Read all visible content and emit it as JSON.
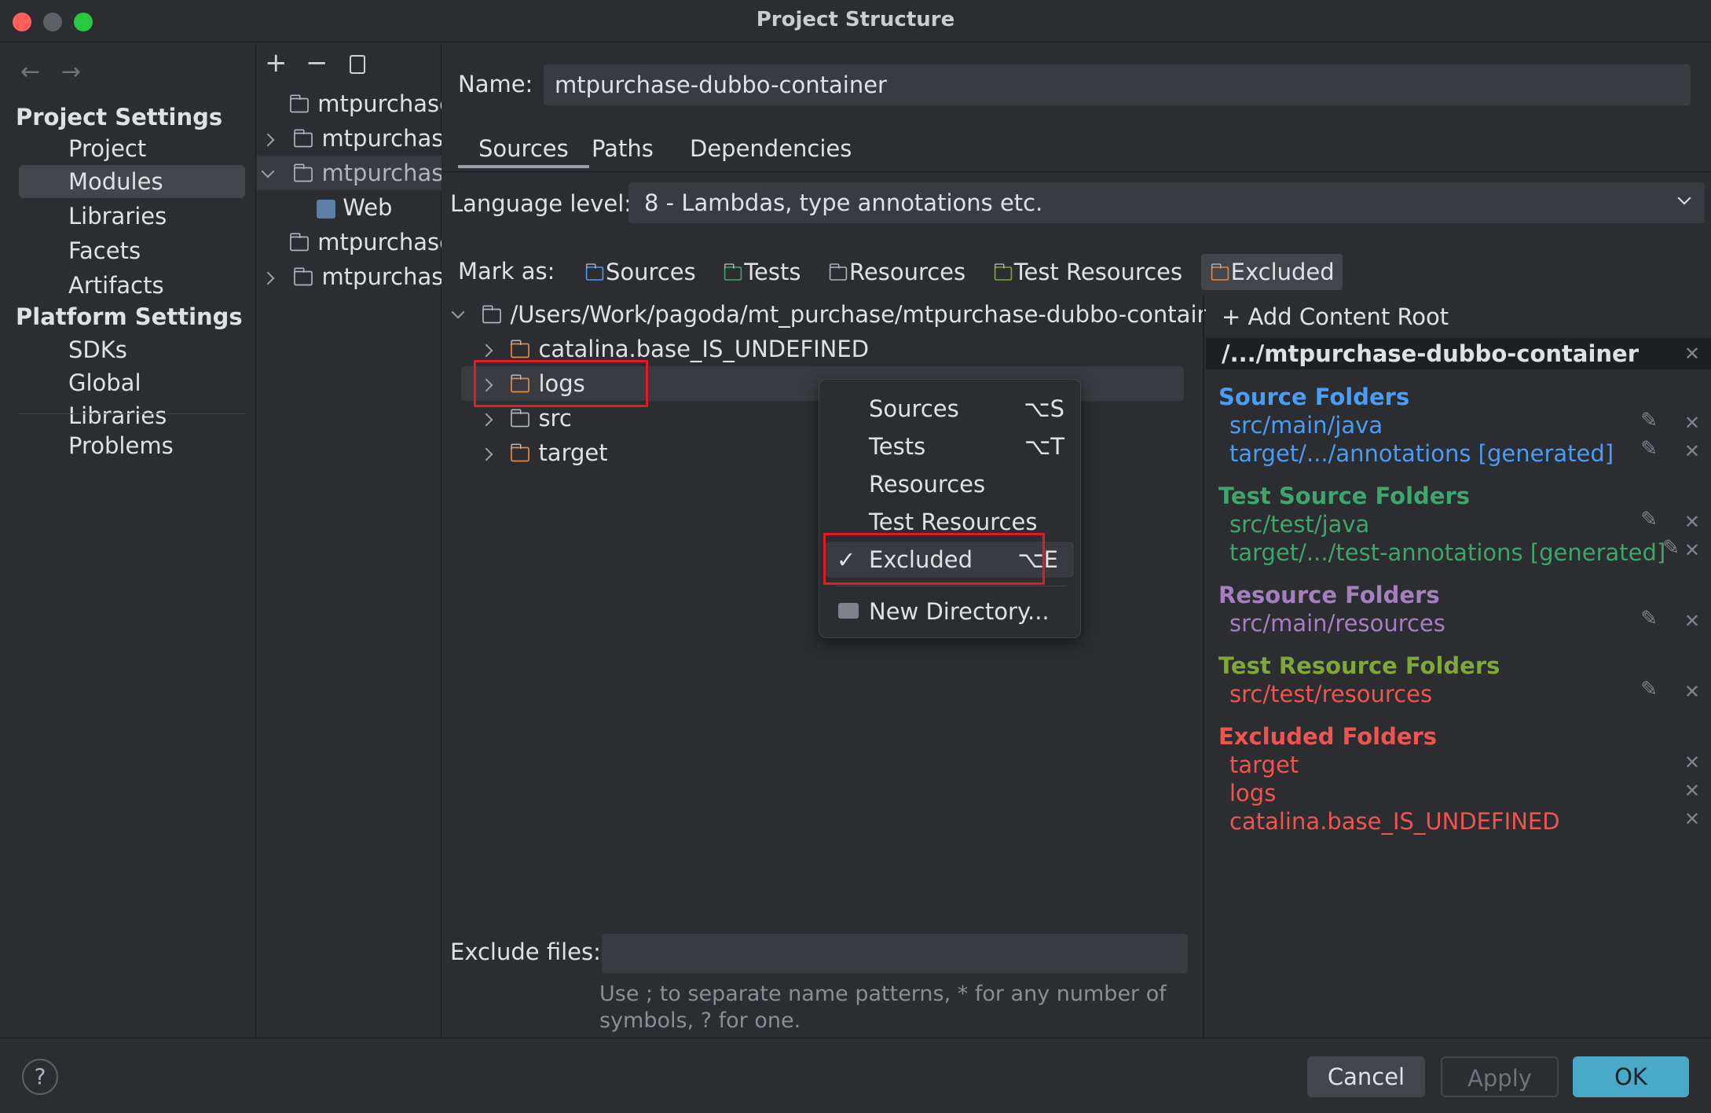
{
  "window": {
    "title": "Project Structure"
  },
  "nav": {
    "project_settings": "Project Settings",
    "platform_settings": "Platform Settings",
    "items": {
      "project": "Project",
      "modules": "Modules",
      "libraries": "Libraries",
      "facets": "Facets",
      "artifacts": "Artifacts",
      "sdks": "SDKs",
      "global_libraries": "Global Libraries",
      "problems": "Problems"
    }
  },
  "modules": {
    "m1": "mtpurchase",
    "m2": "mtpurchase",
    "m3": "mtpurchase",
    "web": "Web",
    "m4": "mtpurchase",
    "m5": "mtpurchase"
  },
  "name": {
    "label": "Name:",
    "value": "mtpurchase-dubbo-container"
  },
  "tabs": {
    "sources": "Sources",
    "paths": "Paths",
    "dependencies": "Dependencies"
  },
  "language": {
    "label": "Language level:",
    "value": "8 - Lambdas, type annotations etc."
  },
  "mark": {
    "label": "Mark as:",
    "sources": "Sources",
    "tests": "Tests",
    "resources": "Resources",
    "test_resources": "Test Resources",
    "excluded": "Excluded"
  },
  "tree": {
    "root": "/Users/Work/pagoda/mt_purchase/mtpurchase-dubbo-containe",
    "catalina": "catalina.base_IS_UNDEFINED",
    "logs": "logs",
    "src": "src",
    "target": "target"
  },
  "menu": {
    "sources": "Sources",
    "sources_sc": "⌥S",
    "tests": "Tests",
    "tests_sc": "⌥T",
    "resources": "Resources",
    "test_resources": "Test Resources",
    "excluded": "Excluded",
    "excluded_sc": "⌥E",
    "check": "✓",
    "new_dir": "New Directory..."
  },
  "right": {
    "add_root": "Add Content Root",
    "root_path": "/.../mtpurchase-dubbo-container",
    "source_hdr": "Source Folders",
    "src1": "src/main/java",
    "src2": "target/.../annotations [generated]",
    "test_hdr": "Test Source Folders",
    "test1": "src/test/java",
    "test2": "target/.../test-annotations [generated]",
    "res_hdr": "Resource Folders",
    "res1": "src/main/resources",
    "tres_hdr": "Test Resource Folders",
    "tres1": "src/test/resources",
    "exc_hdr": "Excluded Folders",
    "exc1": "target",
    "exc2": "logs",
    "exc3": "catalina.base_IS_UNDEFINED"
  },
  "exclude": {
    "label": "Exclude files:",
    "hint1": "Use ; to separate name patterns, * for any number of",
    "hint2": "symbols, ? for one."
  },
  "buttons": {
    "help": "?",
    "cancel": "Cancel",
    "apply": "Apply",
    "ok": "OK"
  },
  "colors": {
    "source": "#4a9cf5",
    "test": "#3fa56a",
    "resource": "#a57fc0",
    "test_resource": "#7fa83a",
    "excluded": "#f0544f",
    "ok": "#4ba9c8"
  }
}
